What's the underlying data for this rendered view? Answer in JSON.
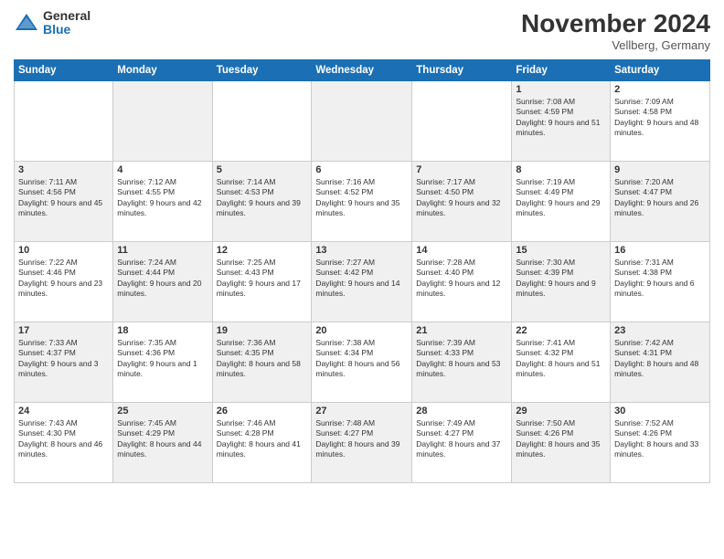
{
  "header": {
    "logo_general": "General",
    "logo_blue": "Blue",
    "month_title": "November 2024",
    "location": "Vellberg, Germany"
  },
  "weekdays": [
    "Sunday",
    "Monday",
    "Tuesday",
    "Wednesday",
    "Thursday",
    "Friday",
    "Saturday"
  ],
  "weeks": [
    [
      null,
      null,
      null,
      null,
      null,
      {
        "day": 1,
        "sunrise": "7:08 AM",
        "sunset": "4:59 PM",
        "daylight": "9 hours and 51 minutes."
      },
      {
        "day": 2,
        "sunrise": "7:09 AM",
        "sunset": "4:58 PM",
        "daylight": "9 hours and 48 minutes."
      }
    ],
    [
      {
        "day": 3,
        "sunrise": "7:11 AM",
        "sunset": "4:56 PM",
        "daylight": "9 hours and 45 minutes."
      },
      {
        "day": 4,
        "sunrise": "7:12 AM",
        "sunset": "4:55 PM",
        "daylight": "9 hours and 42 minutes."
      },
      {
        "day": 5,
        "sunrise": "7:14 AM",
        "sunset": "4:53 PM",
        "daylight": "9 hours and 39 minutes."
      },
      {
        "day": 6,
        "sunrise": "7:16 AM",
        "sunset": "4:52 PM",
        "daylight": "9 hours and 35 minutes."
      },
      {
        "day": 7,
        "sunrise": "7:17 AM",
        "sunset": "4:50 PM",
        "daylight": "9 hours and 32 minutes."
      },
      {
        "day": 8,
        "sunrise": "7:19 AM",
        "sunset": "4:49 PM",
        "daylight": "9 hours and 29 minutes."
      },
      {
        "day": 9,
        "sunrise": "7:20 AM",
        "sunset": "4:47 PM",
        "daylight": "9 hours and 26 minutes."
      }
    ],
    [
      {
        "day": 10,
        "sunrise": "7:22 AM",
        "sunset": "4:46 PM",
        "daylight": "9 hours and 23 minutes."
      },
      {
        "day": 11,
        "sunrise": "7:24 AM",
        "sunset": "4:44 PM",
        "daylight": "9 hours and 20 minutes."
      },
      {
        "day": 12,
        "sunrise": "7:25 AM",
        "sunset": "4:43 PM",
        "daylight": "9 hours and 17 minutes."
      },
      {
        "day": 13,
        "sunrise": "7:27 AM",
        "sunset": "4:42 PM",
        "daylight": "9 hours and 14 minutes."
      },
      {
        "day": 14,
        "sunrise": "7:28 AM",
        "sunset": "4:40 PM",
        "daylight": "9 hours and 12 minutes."
      },
      {
        "day": 15,
        "sunrise": "7:30 AM",
        "sunset": "4:39 PM",
        "daylight": "9 hours and 9 minutes."
      },
      {
        "day": 16,
        "sunrise": "7:31 AM",
        "sunset": "4:38 PM",
        "daylight": "9 hours and 6 minutes."
      }
    ],
    [
      {
        "day": 17,
        "sunrise": "7:33 AM",
        "sunset": "4:37 PM",
        "daylight": "9 hours and 3 minutes."
      },
      {
        "day": 18,
        "sunrise": "7:35 AM",
        "sunset": "4:36 PM",
        "daylight": "9 hours and 1 minute."
      },
      {
        "day": 19,
        "sunrise": "7:36 AM",
        "sunset": "4:35 PM",
        "daylight": "8 hours and 58 minutes."
      },
      {
        "day": 20,
        "sunrise": "7:38 AM",
        "sunset": "4:34 PM",
        "daylight": "8 hours and 56 minutes."
      },
      {
        "day": 21,
        "sunrise": "7:39 AM",
        "sunset": "4:33 PM",
        "daylight": "8 hours and 53 minutes."
      },
      {
        "day": 22,
        "sunrise": "7:41 AM",
        "sunset": "4:32 PM",
        "daylight": "8 hours and 51 minutes."
      },
      {
        "day": 23,
        "sunrise": "7:42 AM",
        "sunset": "4:31 PM",
        "daylight": "8 hours and 48 minutes."
      }
    ],
    [
      {
        "day": 24,
        "sunrise": "7:43 AM",
        "sunset": "4:30 PM",
        "daylight": "8 hours and 46 minutes."
      },
      {
        "day": 25,
        "sunrise": "7:45 AM",
        "sunset": "4:29 PM",
        "daylight": "8 hours and 44 minutes."
      },
      {
        "day": 26,
        "sunrise": "7:46 AM",
        "sunset": "4:28 PM",
        "daylight": "8 hours and 41 minutes."
      },
      {
        "day": 27,
        "sunrise": "7:48 AM",
        "sunset": "4:27 PM",
        "daylight": "8 hours and 39 minutes."
      },
      {
        "day": 28,
        "sunrise": "7:49 AM",
        "sunset": "4:27 PM",
        "daylight": "8 hours and 37 minutes."
      },
      {
        "day": 29,
        "sunrise": "7:50 AM",
        "sunset": "4:26 PM",
        "daylight": "8 hours and 35 minutes."
      },
      {
        "day": 30,
        "sunrise": "7:52 AM",
        "sunset": "4:26 PM",
        "daylight": "8 hours and 33 minutes."
      }
    ]
  ]
}
